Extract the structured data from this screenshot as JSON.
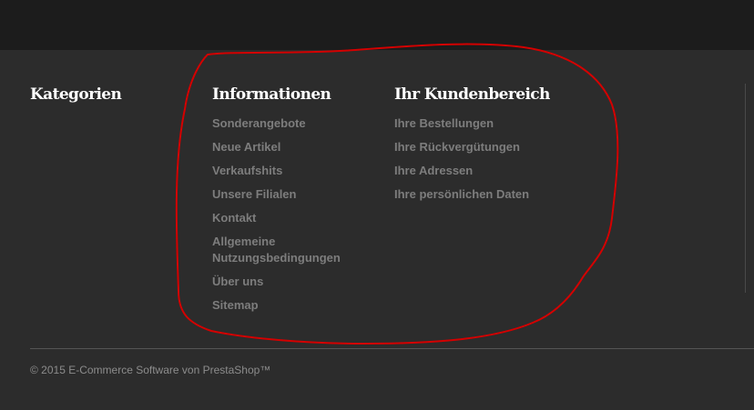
{
  "footer": {
    "kategorien": {
      "title": "Kategorien"
    },
    "informationen": {
      "title": "Informationen",
      "links": [
        "Sonderangebote",
        "Neue Artikel",
        "Verkaufshits",
        "Unsere Filialen",
        "Kontakt",
        "Allgemeine Nutzungsbedingungen",
        "Über uns",
        "Sitemap"
      ]
    },
    "kundenbereich": {
      "title": "Ihr Kundenbereich",
      "links": [
        "Ihre Bestellungen",
        "Ihre Rückvergütungen",
        "Ihre Adressen",
        "Ihre persönlichen Daten"
      ]
    },
    "copyright": "© 2015 E-Commerce Software von PrestaShop™"
  },
  "colors": {
    "topbar": "#1c1c1c",
    "footer_bg": "#2c2c2c",
    "link": "#7d7d7d",
    "heading": "#ffffff",
    "annotation": "#d40000"
  }
}
